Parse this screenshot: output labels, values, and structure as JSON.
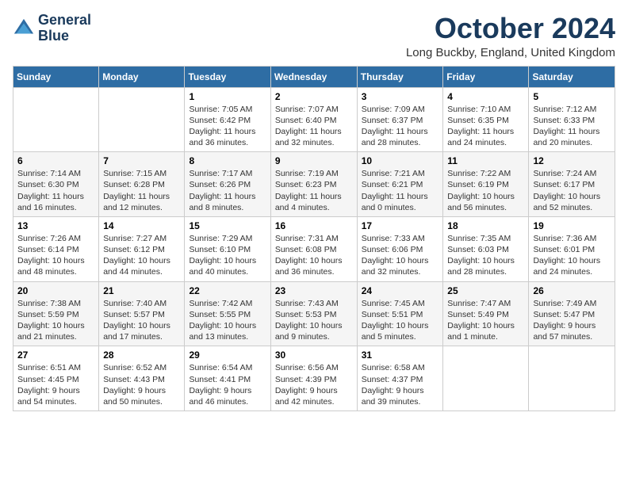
{
  "header": {
    "logo_line1": "General",
    "logo_line2": "Blue",
    "month": "October 2024",
    "location": "Long Buckby, England, United Kingdom"
  },
  "weekdays": [
    "Sunday",
    "Monday",
    "Tuesday",
    "Wednesday",
    "Thursday",
    "Friday",
    "Saturday"
  ],
  "weeks": [
    [
      {
        "day": "",
        "info": ""
      },
      {
        "day": "",
        "info": ""
      },
      {
        "day": "1",
        "info": "Sunrise: 7:05 AM\nSunset: 6:42 PM\nDaylight: 11 hours and 36 minutes."
      },
      {
        "day": "2",
        "info": "Sunrise: 7:07 AM\nSunset: 6:40 PM\nDaylight: 11 hours and 32 minutes."
      },
      {
        "day": "3",
        "info": "Sunrise: 7:09 AM\nSunset: 6:37 PM\nDaylight: 11 hours and 28 minutes."
      },
      {
        "day": "4",
        "info": "Sunrise: 7:10 AM\nSunset: 6:35 PM\nDaylight: 11 hours and 24 minutes."
      },
      {
        "day": "5",
        "info": "Sunrise: 7:12 AM\nSunset: 6:33 PM\nDaylight: 11 hours and 20 minutes."
      }
    ],
    [
      {
        "day": "6",
        "info": "Sunrise: 7:14 AM\nSunset: 6:30 PM\nDaylight: 11 hours and 16 minutes."
      },
      {
        "day": "7",
        "info": "Sunrise: 7:15 AM\nSunset: 6:28 PM\nDaylight: 11 hours and 12 minutes."
      },
      {
        "day": "8",
        "info": "Sunrise: 7:17 AM\nSunset: 6:26 PM\nDaylight: 11 hours and 8 minutes."
      },
      {
        "day": "9",
        "info": "Sunrise: 7:19 AM\nSunset: 6:23 PM\nDaylight: 11 hours and 4 minutes."
      },
      {
        "day": "10",
        "info": "Sunrise: 7:21 AM\nSunset: 6:21 PM\nDaylight: 11 hours and 0 minutes."
      },
      {
        "day": "11",
        "info": "Sunrise: 7:22 AM\nSunset: 6:19 PM\nDaylight: 10 hours and 56 minutes."
      },
      {
        "day": "12",
        "info": "Sunrise: 7:24 AM\nSunset: 6:17 PM\nDaylight: 10 hours and 52 minutes."
      }
    ],
    [
      {
        "day": "13",
        "info": "Sunrise: 7:26 AM\nSunset: 6:14 PM\nDaylight: 10 hours and 48 minutes."
      },
      {
        "day": "14",
        "info": "Sunrise: 7:27 AM\nSunset: 6:12 PM\nDaylight: 10 hours and 44 minutes."
      },
      {
        "day": "15",
        "info": "Sunrise: 7:29 AM\nSunset: 6:10 PM\nDaylight: 10 hours and 40 minutes."
      },
      {
        "day": "16",
        "info": "Sunrise: 7:31 AM\nSunset: 6:08 PM\nDaylight: 10 hours and 36 minutes."
      },
      {
        "day": "17",
        "info": "Sunrise: 7:33 AM\nSunset: 6:06 PM\nDaylight: 10 hours and 32 minutes."
      },
      {
        "day": "18",
        "info": "Sunrise: 7:35 AM\nSunset: 6:03 PM\nDaylight: 10 hours and 28 minutes."
      },
      {
        "day": "19",
        "info": "Sunrise: 7:36 AM\nSunset: 6:01 PM\nDaylight: 10 hours and 24 minutes."
      }
    ],
    [
      {
        "day": "20",
        "info": "Sunrise: 7:38 AM\nSunset: 5:59 PM\nDaylight: 10 hours and 21 minutes."
      },
      {
        "day": "21",
        "info": "Sunrise: 7:40 AM\nSunset: 5:57 PM\nDaylight: 10 hours and 17 minutes."
      },
      {
        "day": "22",
        "info": "Sunrise: 7:42 AM\nSunset: 5:55 PM\nDaylight: 10 hours and 13 minutes."
      },
      {
        "day": "23",
        "info": "Sunrise: 7:43 AM\nSunset: 5:53 PM\nDaylight: 10 hours and 9 minutes."
      },
      {
        "day": "24",
        "info": "Sunrise: 7:45 AM\nSunset: 5:51 PM\nDaylight: 10 hours and 5 minutes."
      },
      {
        "day": "25",
        "info": "Sunrise: 7:47 AM\nSunset: 5:49 PM\nDaylight: 10 hours and 1 minute."
      },
      {
        "day": "26",
        "info": "Sunrise: 7:49 AM\nSunset: 5:47 PM\nDaylight: 9 hours and 57 minutes."
      }
    ],
    [
      {
        "day": "27",
        "info": "Sunrise: 6:51 AM\nSunset: 4:45 PM\nDaylight: 9 hours and 54 minutes."
      },
      {
        "day": "28",
        "info": "Sunrise: 6:52 AM\nSunset: 4:43 PM\nDaylight: 9 hours and 50 minutes."
      },
      {
        "day": "29",
        "info": "Sunrise: 6:54 AM\nSunset: 4:41 PM\nDaylight: 9 hours and 46 minutes."
      },
      {
        "day": "30",
        "info": "Sunrise: 6:56 AM\nSunset: 4:39 PM\nDaylight: 9 hours and 42 minutes."
      },
      {
        "day": "31",
        "info": "Sunrise: 6:58 AM\nSunset: 4:37 PM\nDaylight: 9 hours and 39 minutes."
      },
      {
        "day": "",
        "info": ""
      },
      {
        "day": "",
        "info": ""
      }
    ]
  ]
}
